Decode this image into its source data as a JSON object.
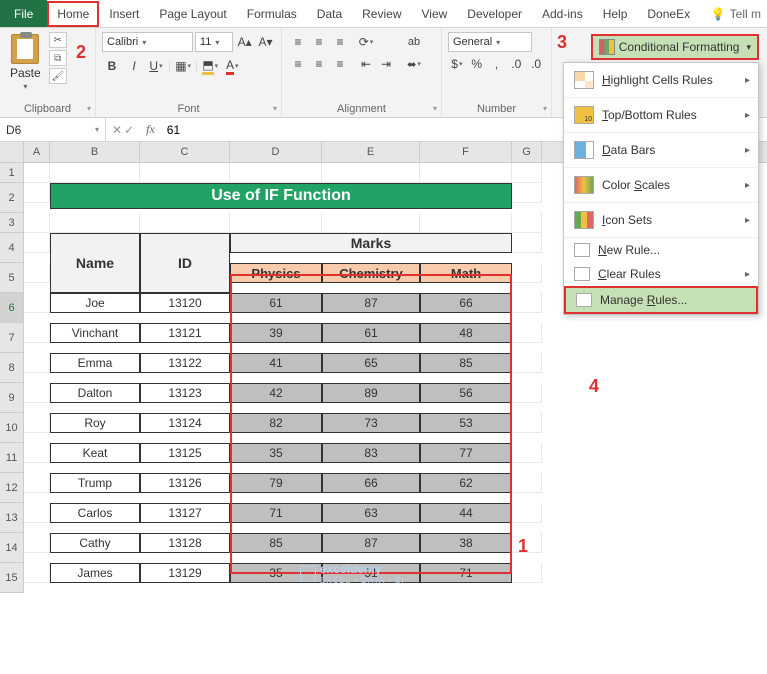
{
  "tabs": {
    "file": "File",
    "home": "Home",
    "items": [
      "Insert",
      "Page Layout",
      "Formulas",
      "Data",
      "Review",
      "View",
      "Developer",
      "Add-ins",
      "Help",
      "DoneEx"
    ],
    "tell_me": "Tell m"
  },
  "ribbon": {
    "clipboard": {
      "paste": "Paste",
      "label": "Clipboard"
    },
    "font": {
      "name": "Calibri",
      "size": "11",
      "label": "Font"
    },
    "alignment": {
      "label": "Alignment"
    },
    "number": {
      "format": "General",
      "label": "Number"
    },
    "cf_button": "Conditional Formatting"
  },
  "cf_menu": {
    "highlight": "Highlight Cells Rules",
    "topbottom": "Top/Bottom Rules",
    "databars": "Data Bars",
    "colorscales": "Color Scales",
    "iconsets": "Icon Sets",
    "newrule": "New Rule...",
    "clear": "Clear Rules",
    "manage": "Manage Rules..."
  },
  "annotations": {
    "n1": "1",
    "n2": "2",
    "n3": "3",
    "n4": "4"
  },
  "fx": {
    "cell_ref": "D6",
    "formula": "61"
  },
  "columns": [
    "A",
    "B",
    "C",
    "D",
    "E",
    "F",
    "G"
  ],
  "title": "Use of IF Function",
  "headers": {
    "name": "Name",
    "id": "ID",
    "marks": "Marks",
    "physics": "Physics",
    "chemistry": "Chemistry",
    "math": "Math"
  },
  "students": [
    {
      "name": "Joe",
      "id": "13120",
      "p": "61",
      "c": "87",
      "m": "66"
    },
    {
      "name": "Vinchant",
      "id": "13121",
      "p": "39",
      "c": "61",
      "m": "48"
    },
    {
      "name": "Emma",
      "id": "13122",
      "p": "41",
      "c": "65",
      "m": "85"
    },
    {
      "name": "Dalton",
      "id": "13123",
      "p": "42",
      "c": "89",
      "m": "56"
    },
    {
      "name": "Roy",
      "id": "13124",
      "p": "82",
      "c": "73",
      "m": "53"
    },
    {
      "name": "Keat",
      "id": "13125",
      "p": "35",
      "c": "83",
      "m": "77"
    },
    {
      "name": "Trump",
      "id": "13126",
      "p": "79",
      "c": "66",
      "m": "62"
    },
    {
      "name": "Carlos",
      "id": "13127",
      "p": "71",
      "c": "63",
      "m": "44"
    },
    {
      "name": "Cathy",
      "id": "13128",
      "p": "85",
      "c": "87",
      "m": "38"
    },
    {
      "name": "James",
      "id": "13129",
      "p": "35",
      "c": "51",
      "m": "71"
    }
  ],
  "watermark": {
    "brand": "exceldemy",
    "sub": "EXCEL • DATA • BI"
  }
}
